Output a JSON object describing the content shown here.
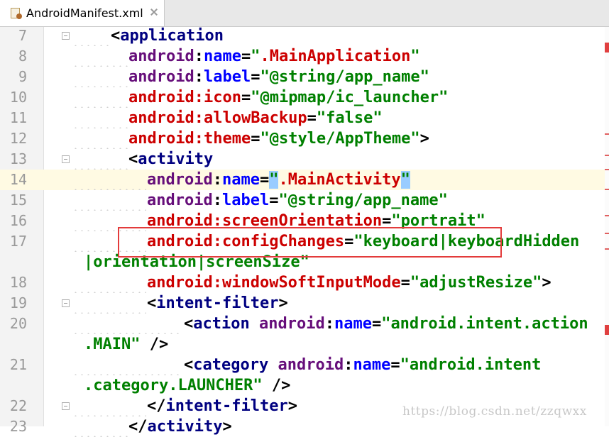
{
  "tab": {
    "title": "AndroidManifest.xml",
    "file_icon": "xml-manifest-icon",
    "close_icon": "close-icon"
  },
  "lines": [
    {
      "num": "7"
    },
    {
      "num": "8"
    },
    {
      "num": "9"
    },
    {
      "num": "10"
    },
    {
      "num": "11"
    },
    {
      "num": "12"
    },
    {
      "num": "13"
    },
    {
      "num": "14"
    },
    {
      "num": "15"
    },
    {
      "num": "16"
    },
    {
      "num": "17"
    },
    {
      "num": "18"
    },
    {
      "num": "19"
    },
    {
      "num": "20"
    },
    {
      "num": "21"
    },
    {
      "num": "22"
    },
    {
      "num": "23"
    }
  ],
  "code": {
    "application_tag": "application",
    "ns": "android",
    "attr_name": "name",
    "val_main_app": ".MainApplication",
    "attr_label": "label",
    "val_app_name": "@string/app_name",
    "attr_icon": "icon",
    "val_icon": "@mipmap/ic_launcher",
    "attr_allow_backup": "allowBackup",
    "val_false": "false",
    "attr_theme": "theme",
    "val_theme": "@style/AppTheme",
    "activity_tag": "activity",
    "val_main_activity": ".MainActivity",
    "attr_screen_orientation": "screenOrientation",
    "val_portrait": "portrait",
    "attr_config_changes": "configChanges",
    "val_config_a": "keyboard|keyboardHidden",
    "val_config_b": "|orientation|screenSize",
    "attr_soft_input": "windowSoftInputMode",
    "val_adjust_resize": "adjustResize",
    "intent_filter_tag": "intent-filter",
    "action_tag": "action",
    "val_action_a": "android.intent.action",
    "val_action_b": ".MAIN",
    "category_tag": "category",
    "val_category_a": "android.intent",
    "val_category_b": ".category.LAUNCHER",
    "close_intent_filter": "intent-filter",
    "close_activity": "activity"
  },
  "watermark": "https://blog.csdn.net/zzqwxx",
  "colors": {
    "highlight_box": "#e33b3b",
    "current_line": "#fffae3",
    "string_green": "#008000",
    "namespace_purple": "#660e7a",
    "attribute_blue": "#0000ff",
    "error_red": "#cc0000"
  }
}
